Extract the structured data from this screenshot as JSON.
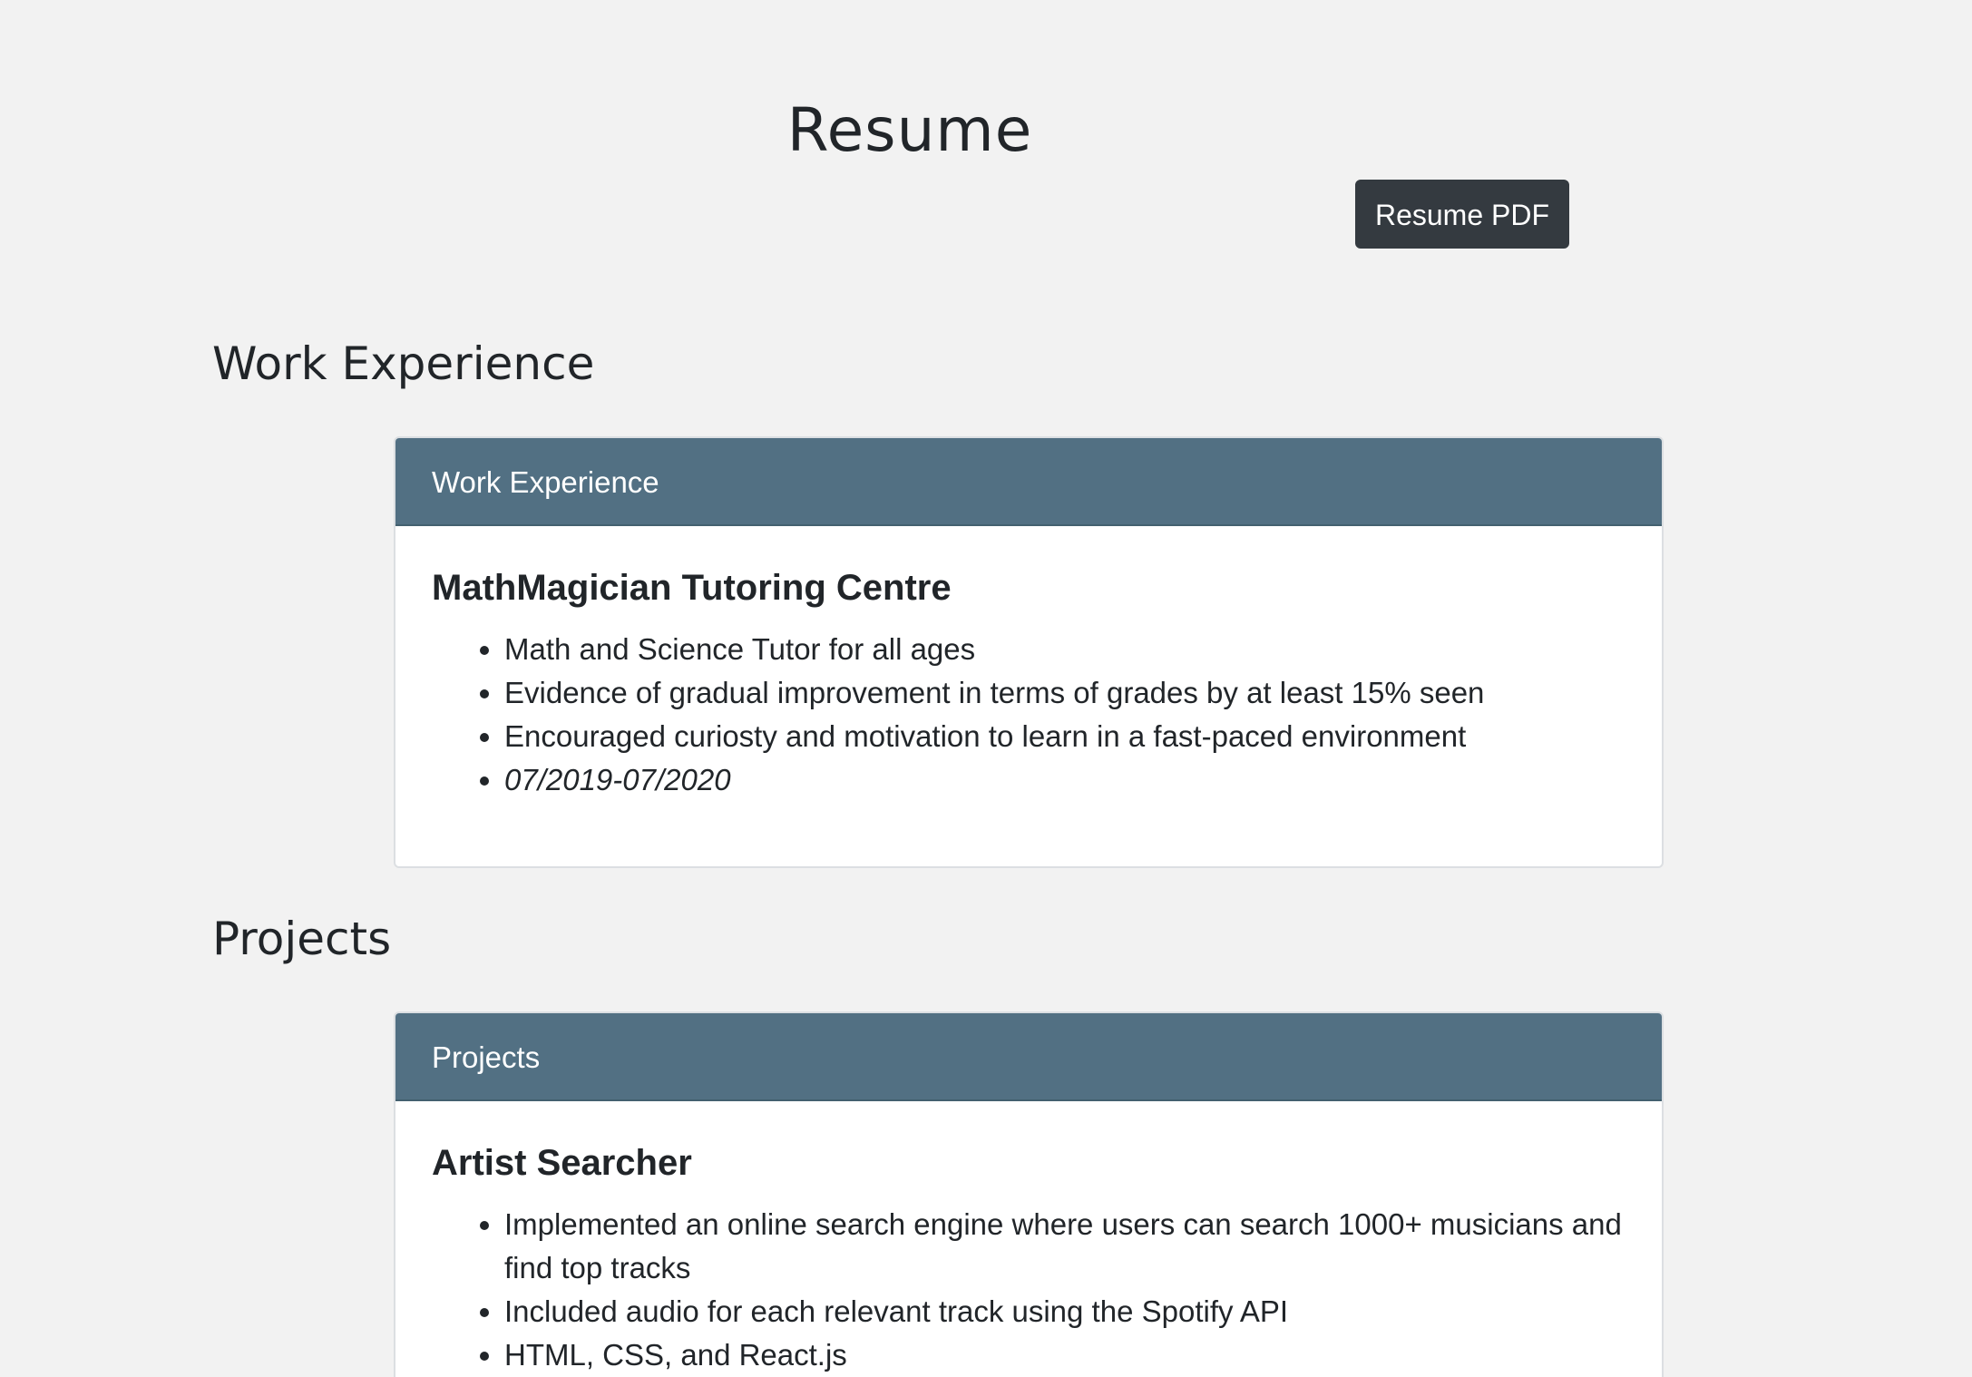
{
  "header": {
    "title": "Resume",
    "pdf_button_label": "Resume PDF"
  },
  "work": {
    "section_title": "Work Experience",
    "card_header": "Work Experience",
    "entry_title": "MathMagician Tutoring Centre",
    "bullets": [
      "Math and Science Tutor for all ages",
      "Evidence of gradual improvement in terms of grades by at least 15% seen",
      "Encouraged curiosty and motivation to learn in a fast-paced environment"
    ],
    "dates": "07/2019-07/2020"
  },
  "projects": {
    "section_title": "Projects",
    "card_header": "Projects",
    "entry_title": "Artist Searcher",
    "bullets": [
      "Implemented an online search engine where users can search 1000+ musicians and find top tracks",
      "Included audio for each relevant track using the Spotify API",
      "HTML, CSS, and React.js"
    ]
  }
}
